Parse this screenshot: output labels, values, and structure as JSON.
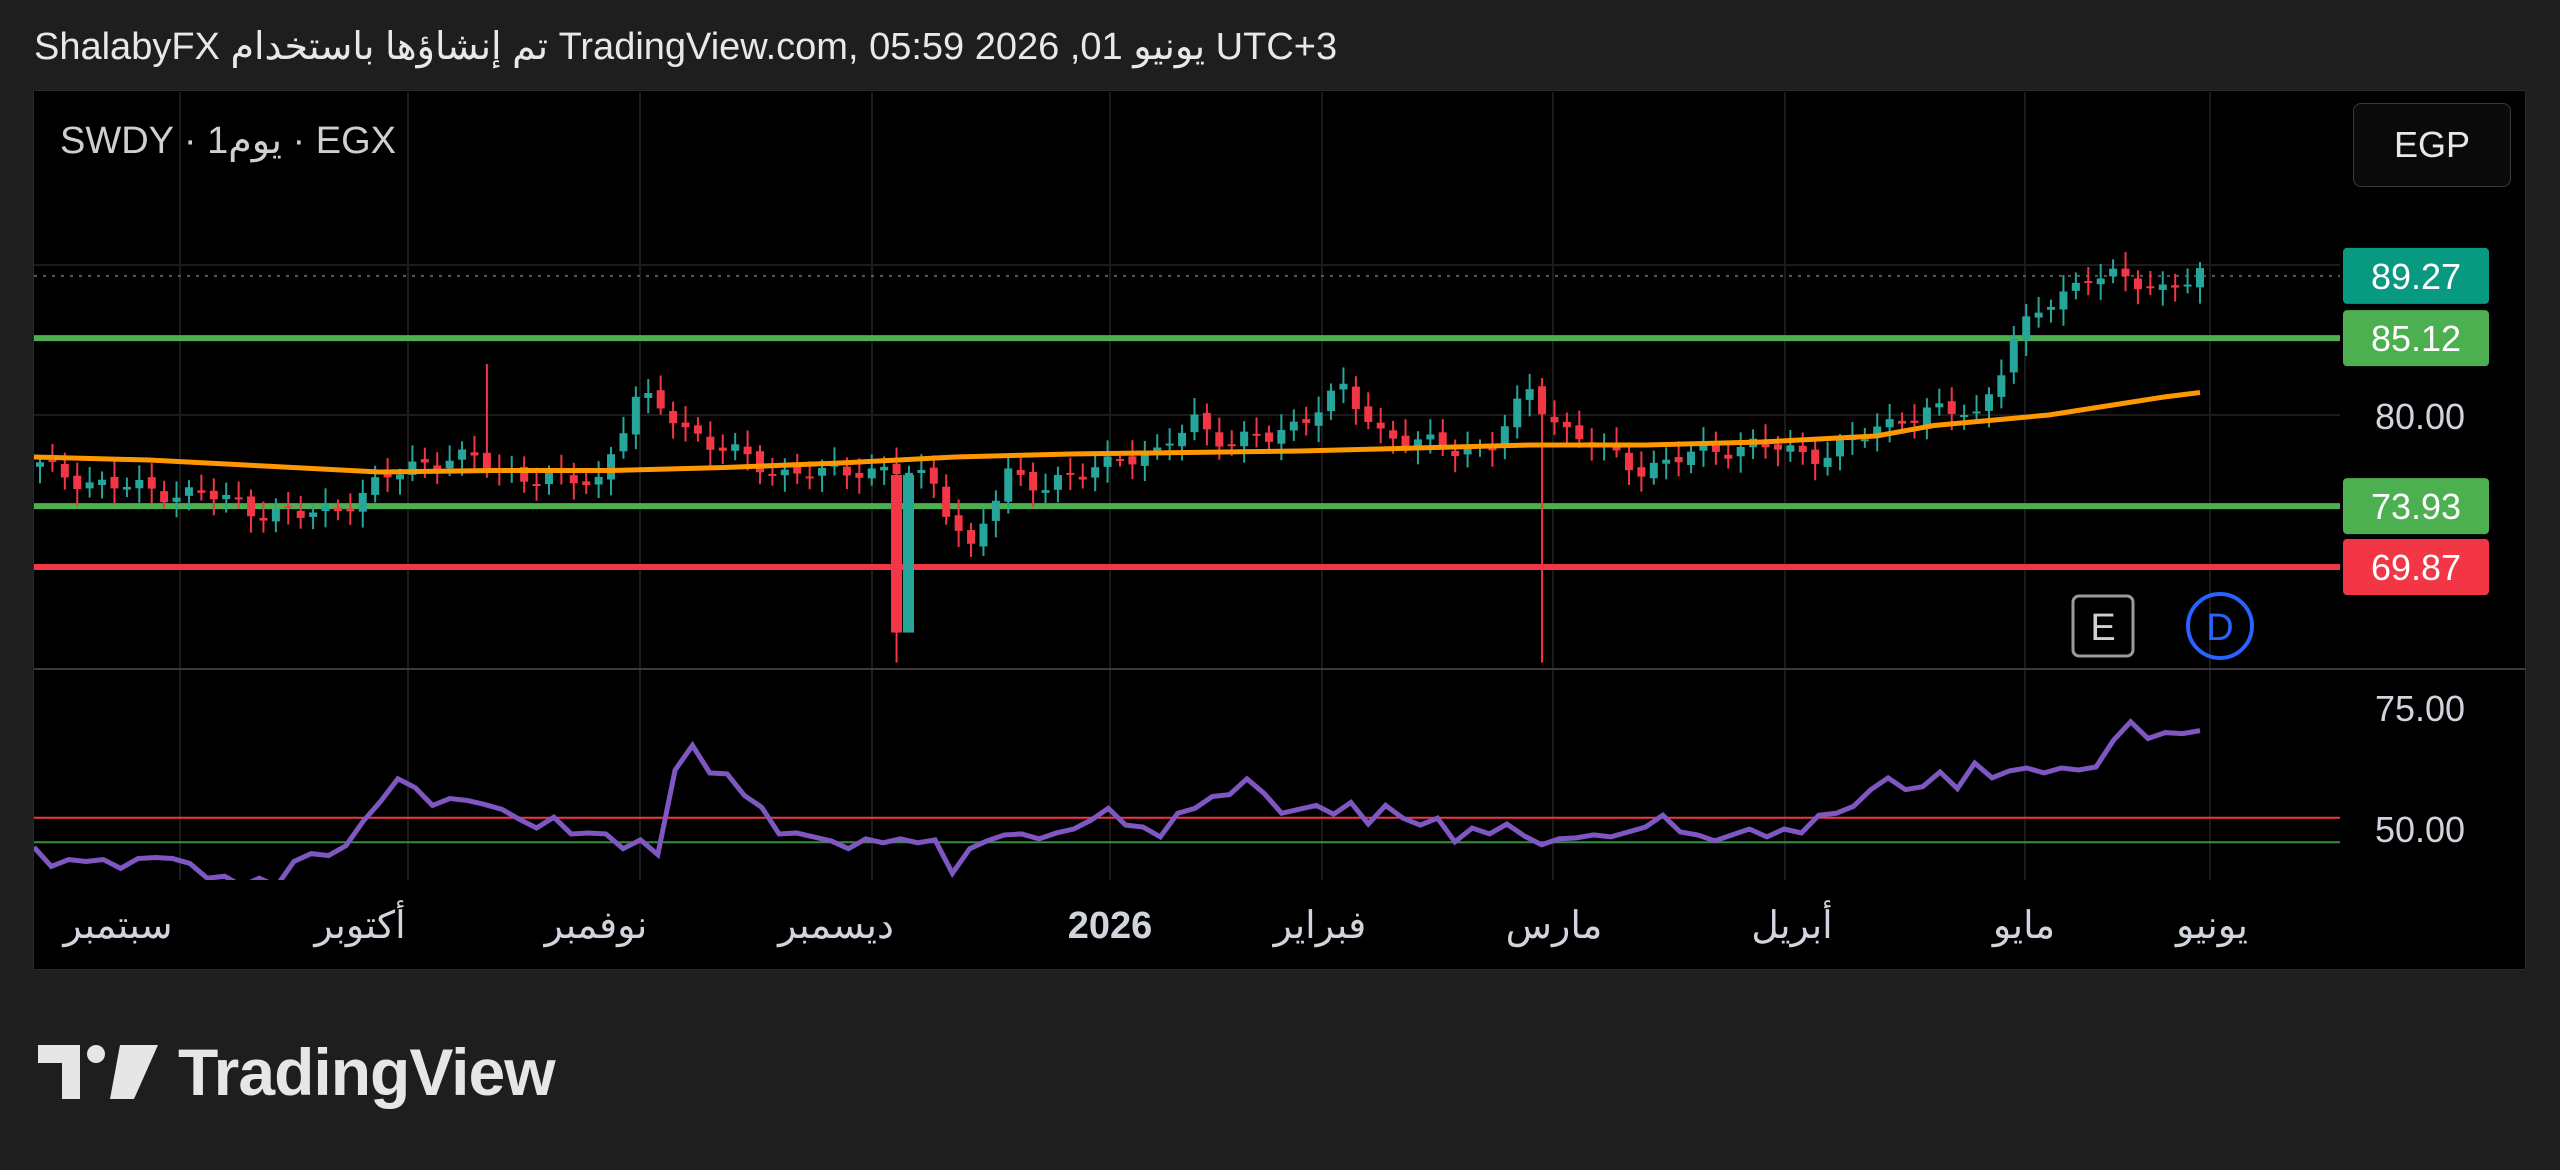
{
  "header": {
    "text": "ShalabyFX تم إنشاؤها باستخدام TradingView.com, 05:59 2026 ,01 يونيو UTC+3"
  },
  "symbol": {
    "label": "SWDY · 1يوم · EGX"
  },
  "currency": {
    "label": "EGP"
  },
  "badges": {
    "event": "E",
    "dividend": "D"
  },
  "logo": {
    "text": "TradingView"
  },
  "colors": {
    "up": "#26a69a",
    "down": "#f23645",
    "ma": "#ff9800",
    "rsi": "#7e57c2",
    "support_green": "#4caf50",
    "resistance_red": "#f23645",
    "last_price_bg": "#089981"
  },
  "chart_data": {
    "type": "candlestick",
    "price_axis": {
      "ticks": [
        "80.00"
      ],
      "range": [
        64,
        93
      ]
    },
    "rsi_axis": {
      "ticks": [
        "75.00",
        "50.00"
      ],
      "range": [
        38,
        80
      ]
    },
    "x_labels": [
      "سبتمبر",
      "أكتوبر",
      "نوفمبر",
      "ديسمبر",
      "2026",
      "فبراير",
      "مارس",
      "أبريل",
      "مايو",
      "يونيو"
    ],
    "price_labels": [
      {
        "value": "89.27",
        "kind": "last"
      },
      {
        "value": "85.12",
        "kind": "support"
      },
      {
        "value": "73.93",
        "kind": "support"
      },
      {
        "value": "69.87",
        "kind": "resistance"
      }
    ],
    "horizontal_lines": [
      {
        "y": 85.12,
        "color": "green"
      },
      {
        "y": 73.93,
        "color": "green"
      },
      {
        "y": 69.87,
        "color": "red"
      }
    ],
    "rsi_levels": [
      52.5,
      47.5
    ],
    "candle_key_closes": [
      76.5,
      75.8,
      75.2,
      75.0,
      74.8,
      74.3,
      73.6,
      73.2,
      73.9,
      75.2,
      76.7,
      77.2,
      76.7,
      76.0,
      75.5,
      75.8,
      81.0,
      80.0,
      78.0,
      77.0,
      76.2,
      76.0,
      76.5,
      76.2,
      75.5,
      71.0,
      76.0,
      75.5,
      75.8,
      77.5,
      77.2,
      79.8,
      78.0,
      78.5,
      80.0,
      81.5,
      79.0,
      78.0,
      77.8,
      78.0,
      81.5,
      79.0,
      77.5,
      76.5,
      77.0,
      77.8,
      78.0,
      77.5,
      77.5,
      78.5,
      80.0,
      80.2,
      80.0,
      85.0,
      87.5,
      89.5,
      88.8,
      88.6,
      89.27
    ],
    "ma_points": [
      [
        0,
        77.2
      ],
      [
        80,
        77.0
      ],
      [
        160,
        76.6
      ],
      [
        240,
        76.2
      ],
      [
        320,
        76.3
      ],
      [
        400,
        76.3
      ],
      [
        480,
        76.5
      ],
      [
        560,
        76.8
      ],
      [
        640,
        77.2
      ],
      [
        720,
        77.4
      ],
      [
        800,
        77.5
      ],
      [
        880,
        77.6
      ],
      [
        960,
        77.8
      ],
      [
        1040,
        78.0
      ],
      [
        1120,
        78.0
      ],
      [
        1200,
        78.2
      ],
      [
        1280,
        78.6
      ],
      [
        1320,
        79.3
      ],
      [
        1400,
        80.0
      ],
      [
        1440,
        80.6
      ],
      [
        1480,
        81.2
      ],
      [
        1505,
        81.5
      ]
    ],
    "rsi_points": [
      [
        0,
        46.5
      ],
      [
        20,
        42.6
      ],
      [
        40,
        44.0
      ],
      [
        60,
        43.6
      ],
      [
        80,
        44.0
      ],
      [
        100,
        42.2
      ],
      [
        120,
        44.2
      ],
      [
        140,
        44.4
      ],
      [
        160,
        44.2
      ],
      [
        180,
        43.2
      ],
      [
        200,
        40.2
      ],
      [
        220,
        40.6
      ],
      [
        240,
        38.6
      ],
      [
        260,
        40.2
      ],
      [
        280,
        38.6
      ],
      [
        300,
        43.6
      ],
      [
        320,
        45.2
      ],
      [
        340,
        44.8
      ],
      [
        360,
        46.8
      ],
      [
        380,
        51.8
      ],
      [
        400,
        55.8
      ],
      [
        420,
        60.4
      ],
      [
        440,
        58.6
      ],
      [
        460,
        55.0
      ],
      [
        480,
        56.4
      ],
      [
        500,
        56.0
      ],
      [
        520,
        55.2
      ],
      [
        540,
        54.2
      ],
      [
        560,
        52.2
      ],
      [
        580,
        50.4
      ],
      [
        600,
        52.6
      ],
      [
        620,
        49.2
      ],
      [
        640,
        49.4
      ],
      [
        660,
        49.2
      ],
      [
        680,
        46.2
      ],
      [
        700,
        48.0
      ],
      [
        720,
        45.0
      ],
      [
        740,
        62.2
      ],
      [
        760,
        67.2
      ],
      [
        780,
        61.6
      ],
      [
        800,
        61.4
      ],
      [
        820,
        57.0
      ],
      [
        840,
        54.6
      ],
      [
        860,
        49.2
      ],
      [
        880,
        49.4
      ],
      [
        900,
        48.6
      ],
      [
        920,
        47.8
      ],
      [
        940,
        46.2
      ],
      [
        960,
        48.2
      ],
      [
        980,
        47.4
      ],
      [
        1000,
        48.2
      ],
      [
        1020,
        47.4
      ],
      [
        1040,
        48.0
      ],
      [
        1060,
        41.2
      ],
      [
        1080,
        46.2
      ],
      [
        1100,
        47.8
      ],
      [
        1120,
        49.0
      ],
      [
        1140,
        49.2
      ],
      [
        1160,
        48.2
      ],
      [
        1180,
        49.4
      ],
      [
        1200,
        50.2
      ],
      [
        1220,
        52.0
      ],
      [
        1240,
        54.4
      ],
      [
        1260,
        51.0
      ],
      [
        1280,
        50.6
      ],
      [
        1300,
        48.6
      ],
      [
        1320,
        53.4
      ],
      [
        1340,
        54.4
      ],
      [
        1360,
        56.8
      ],
      [
        1380,
        57.2
      ],
      [
        1400,
        60.4
      ],
      [
        1420,
        57.4
      ],
      [
        1440,
        53.4
      ],
      [
        1460,
        54.2
      ],
      [
        1480,
        55.0
      ],
      [
        1500,
        53.2
      ],
      [
        1520,
        55.6
      ],
      [
        1540,
        51.2
      ],
      [
        1560,
        55.0
      ],
      [
        1580,
        52.4
      ],
      [
        1600,
        51.0
      ],
      [
        1620,
        52.4
      ],
      [
        1640,
        47.6
      ],
      [
        1660,
        50.4
      ],
      [
        1680,
        49.2
      ],
      [
        1700,
        51.2
      ],
      [
        1720,
        48.8
      ],
      [
        1740,
        47.0
      ],
      [
        1760,
        48.2
      ],
      [
        1780,
        48.4
      ],
      [
        1800,
        49.0
      ],
      [
        1820,
        48.6
      ],
      [
        1840,
        49.6
      ],
      [
        1860,
        50.6
      ],
      [
        1880,
        53.0
      ],
      [
        1900,
        49.6
      ],
      [
        1920,
        49.0
      ],
      [
        1940,
        47.8
      ],
      [
        1960,
        49.0
      ],
      [
        1980,
        50.2
      ],
      [
        2000,
        48.6
      ],
      [
        2020,
        50.2
      ],
      [
        2040,
        49.4
      ],
      [
        2060,
        53.0
      ],
      [
        2080,
        53.4
      ],
      [
        2100,
        54.8
      ],
      [
        2120,
        58.2
      ],
      [
        2140,
        60.6
      ],
      [
        2160,
        58.2
      ],
      [
        2180,
        58.8
      ],
      [
        2200,
        61.8
      ],
      [
        2220,
        58.4
      ],
      [
        2240,
        63.6
      ],
      [
        2260,
        60.6
      ],
      [
        2280,
        62.0
      ],
      [
        2300,
        62.6
      ],
      [
        2320,
        61.6
      ],
      [
        2340,
        62.6
      ],
      [
        2360,
        62.2
      ],
      [
        2380,
        62.8
      ],
      [
        2400,
        68.2
      ],
      [
        2420,
        72.0
      ],
      [
        2440,
        68.6
      ],
      [
        2460,
        69.8
      ],
      [
        2480,
        69.6
      ],
      [
        2500,
        70.2
      ]
    ]
  }
}
